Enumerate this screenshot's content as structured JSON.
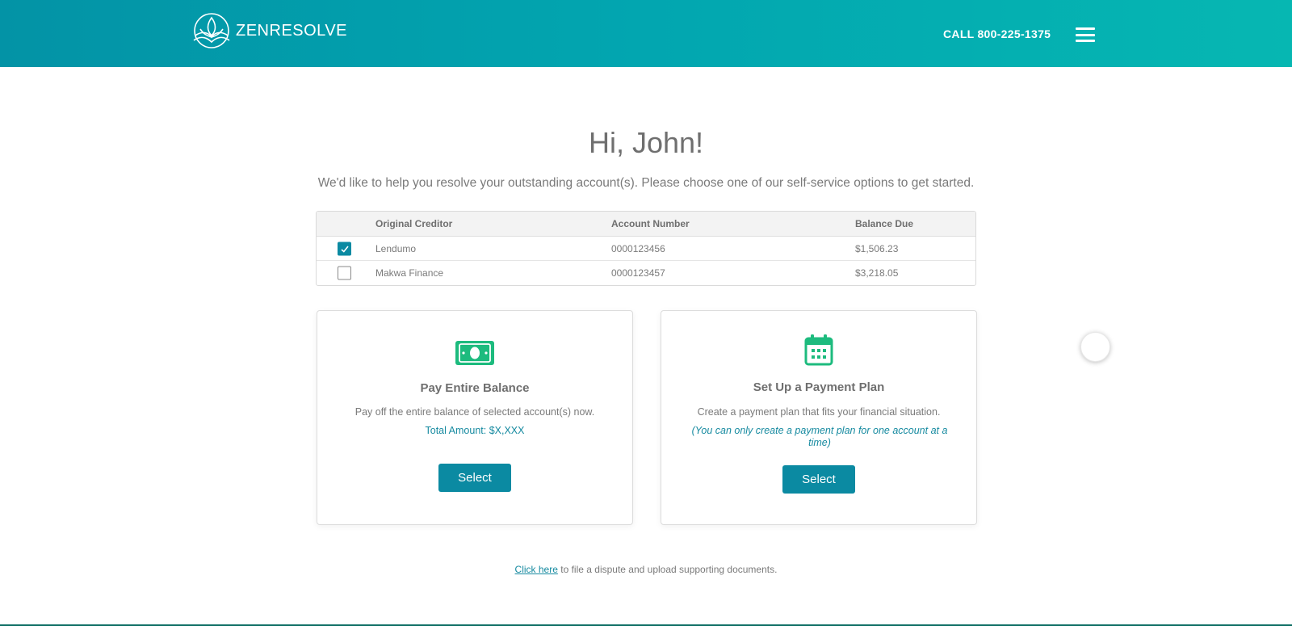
{
  "header": {
    "brand": "ZENRESOLVE",
    "call_text": "CALL 800-225-1375"
  },
  "greeting": "Hi, John!",
  "intro": "We'd like to help you resolve your outstanding account(s). Please choose one of our self-service options to get started.",
  "accounts": {
    "columns": [
      "Original Creditor",
      "Account Number",
      "Balance Due"
    ],
    "rows": [
      {
        "creditor": "Lendumo",
        "account": "0000123456",
        "balance": "$1,506.23",
        "checked": true
      },
      {
        "creditor": "Makwa Finance",
        "account": "0000123457",
        "balance": "$3,218.05",
        "checked": false
      }
    ]
  },
  "cards": {
    "pay": {
      "title": "Pay Entire Balance",
      "desc": "Pay off the entire balance of  selected account(s) now.",
      "total": "Total Amount: $X,XXX",
      "button": "Select"
    },
    "plan": {
      "title": "Set Up a Payment Plan",
      "desc": "Create a payment plan that fits your financial situation.",
      "note": "(You can only create a payment plan for one account at a time)",
      "button": "Select"
    }
  },
  "footer": {
    "link": "Click here",
    "text": " to file a dispute and upload supporting documents."
  },
  "colors": {
    "accent": "#0b8aa2",
    "icon_green": "#1dbb7e",
    "header_gradient_start": "#0393a6",
    "header_gradient_end": "#06b7b2"
  }
}
